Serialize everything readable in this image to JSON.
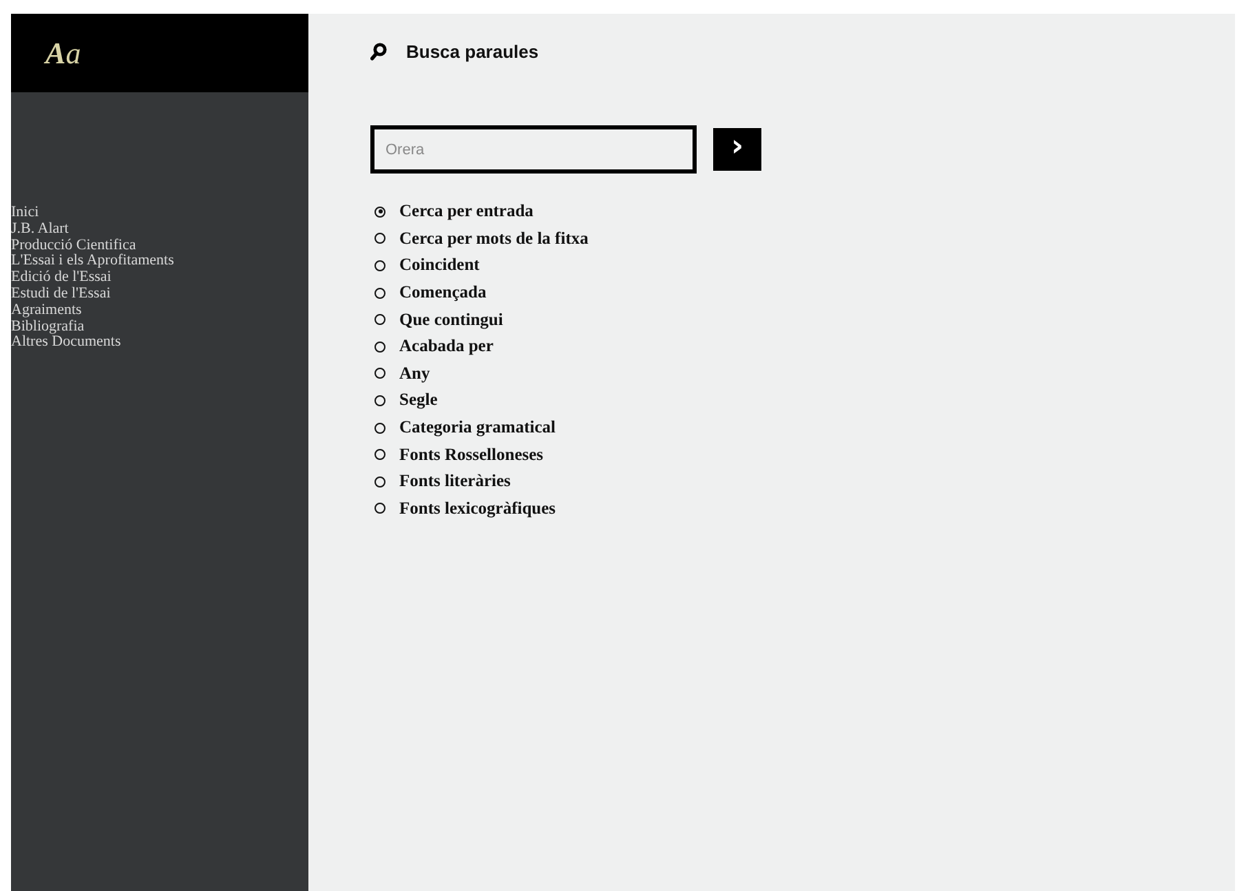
{
  "logo": "**A**a",
  "sidebar": {
    "items": [
      {
        "label": "Inici"
      },
      {
        "label": "J.B. Alart"
      },
      {
        "label": "Producció Cientifica"
      },
      {
        "label": "L'Essai i els Aprofitaments"
      },
      {
        "label": "Edició de l'Essai"
      },
      {
        "label": "Estudi de l'Essai"
      },
      {
        "label": "Agraiments"
      },
      {
        "label": "Bibliografia"
      },
      {
        "label": "Altres Documents"
      }
    ]
  },
  "search": {
    "title": "Busca paraules",
    "placeholder": "Orera",
    "submit": "›"
  },
  "options": [
    {
      "label": "Cerca per entrada",
      "selected": true
    },
    {
      "label": "Cerca per mots de la fitxa",
      "selected": false
    },
    {
      "label": "Coincident",
      "selected": false
    },
    {
      "label": "Començada",
      "selected": false
    },
    {
      "label": "Que contingui",
      "selected": false
    },
    {
      "label": "Acabada per",
      "selected": false
    },
    {
      "label": "Any",
      "selected": false
    },
    {
      "label": "Segle",
      "selected": false
    },
    {
      "label": "Categoria gramatical",
      "selected": false
    },
    {
      "label": "Fonts Rosselloneses",
      "selected": false
    },
    {
      "label": "Fonts literàries",
      "selected": false
    },
    {
      "label": "Fonts lexicogràfiques",
      "selected": false
    }
  ]
}
